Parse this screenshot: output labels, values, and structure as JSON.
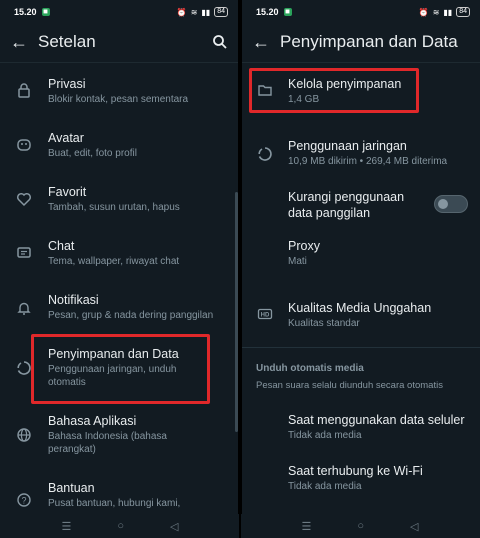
{
  "left": {
    "status": {
      "time": "15.20",
      "battery": "84"
    },
    "title": "Setelan",
    "items": [
      {
        "icon": "lock-icon",
        "label": "Privasi",
        "sub": "Blokir kontak, pesan sementara"
      },
      {
        "icon": "avatar-icon",
        "label": "Avatar",
        "sub": "Buat, edit, foto profil"
      },
      {
        "icon": "heart-icon",
        "label": "Favorit",
        "sub": "Tambah, susun urutan, hapus"
      },
      {
        "icon": "chat-icon",
        "label": "Chat",
        "sub": "Tema, wallpaper, riwayat chat"
      },
      {
        "icon": "bell-icon",
        "label": "Notifikasi",
        "sub": "Pesan, grup & nada dering panggilan"
      },
      {
        "icon": "storage-icon",
        "label": "Penyimpanan dan Data",
        "sub": "Penggunaan jaringan, unduh otomatis"
      },
      {
        "icon": "globe-icon",
        "label": "Bahasa Aplikasi",
        "sub": "Bahasa Indonesia (bahasa perangkat)"
      },
      {
        "icon": "help-icon",
        "label": "Bantuan",
        "sub": "Pusat bantuan, hubungi kami,"
      }
    ]
  },
  "right": {
    "status": {
      "time": "15.20",
      "battery": "84"
    },
    "title": "Penyimpanan dan Data",
    "items": [
      {
        "icon": "folder-icon",
        "label": "Kelola penyimpanan",
        "sub": "1,4 GB"
      },
      {
        "icon": "network-usage-icon",
        "label": "Penggunaan jaringan",
        "sub": "10,9 MB dikirim • 269,4 MB diterima"
      },
      {
        "icon": "",
        "label": "Kurangi penggunaan data panggilan",
        "sub": ""
      },
      {
        "icon": "",
        "label": "Proxy",
        "sub": "Mati"
      },
      {
        "icon": "hd-icon",
        "label": "Kualitas Media Unggahan",
        "sub": "Kualitas standar"
      }
    ],
    "section": {
      "title": "Unduh otomatis media",
      "subtitle": "Pesan suara selalu diunduh secara otomatis"
    },
    "auto_items": [
      {
        "label": "Saat menggunakan data seluler",
        "sub": "Tidak ada media"
      },
      {
        "label": "Saat terhubung ke Wi-Fi",
        "sub": "Tidak ada media"
      }
    ],
    "toggle_on": false
  },
  "colors": {
    "accent": "#e0282a",
    "background": "#121b22",
    "secondary_text": "#8696a0"
  }
}
